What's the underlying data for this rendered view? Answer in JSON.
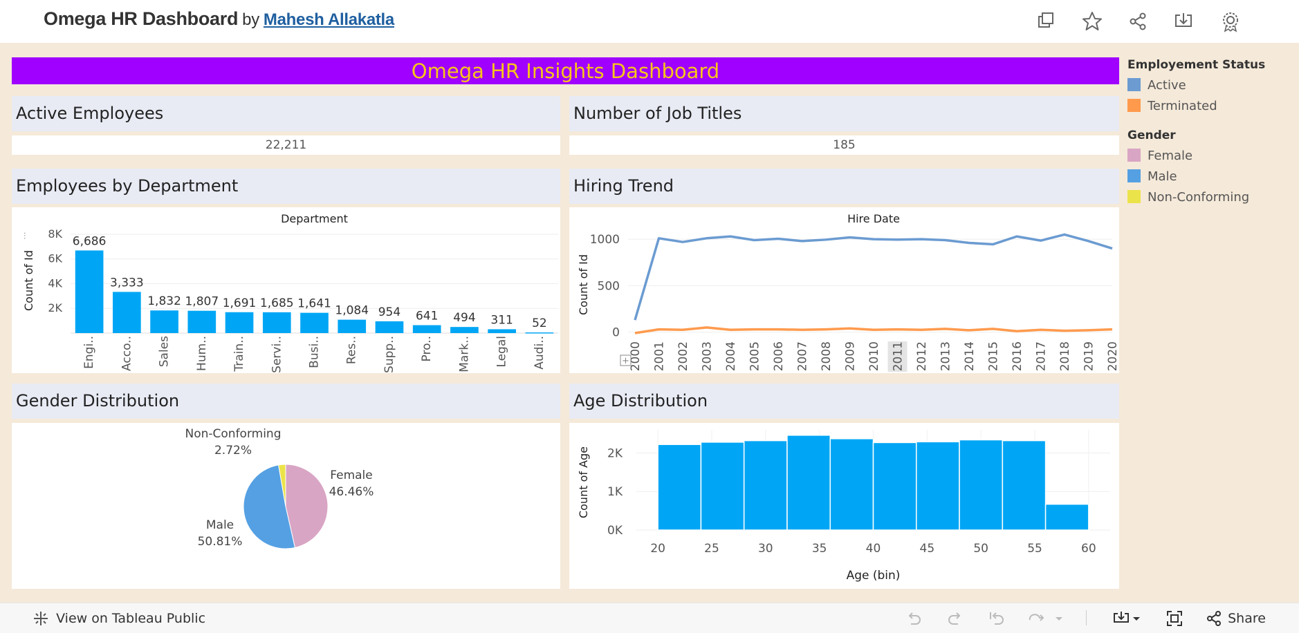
{
  "header": {
    "title": "Omega HR Dashboard",
    "by": "by",
    "author": "Mahesh Allakatla",
    "icons": [
      "duplicate-icon",
      "star-icon",
      "share-icon",
      "download-icon",
      "badge-icon"
    ]
  },
  "banner": "Omega HR Insights Dashboard",
  "kpis": {
    "active_label": "Active Employees",
    "active_value": "22,211",
    "jobs_label": "Number of Job Titles",
    "jobs_value": "185"
  },
  "panels": {
    "dept": "Employees by Department",
    "hiring": "Hiring Trend",
    "gender": "Gender Distribution",
    "age": "Age Distribution"
  },
  "legend": {
    "status_title": "Employement Status",
    "status_items": [
      {
        "label": "Active",
        "color": "#6b9bd1"
      },
      {
        "label": "Terminated",
        "color": "#ff9a4d"
      }
    ],
    "gender_title": "Gender",
    "gender_items": [
      {
        "label": "Female",
        "color": "#d9a5c4"
      },
      {
        "label": "Male",
        "color": "#55a0e3"
      },
      {
        "label": "Non-Conforming",
        "color": "#ebe34a"
      }
    ]
  },
  "chart_data": [
    {
      "type": "bar",
      "title": "Department",
      "ylabel": "Count of Id",
      "ylim": [
        0,
        8500
      ],
      "yticks": [
        2000,
        4000,
        6000,
        8000
      ],
      "ytick_labels": [
        "2K",
        "4K",
        "6K",
        "8K"
      ],
      "categories": [
        "Engi..",
        "Acco..",
        "Sales",
        "Hum..",
        "Train..",
        "Servi..",
        "Busi..",
        "Res..",
        "Supp..",
        "Pro..",
        "Mark..",
        "Legal",
        "Audi.."
      ],
      "values": [
        6686,
        3333,
        1832,
        1807,
        1691,
        1685,
        1641,
        1084,
        954,
        641,
        494,
        311,
        52
      ],
      "labels": [
        "6,686",
        "3,333",
        "1,832",
        "1,807",
        "1,691",
        "1,685",
        "1,641",
        "1,084",
        "954",
        "641",
        "494",
        "311",
        "52"
      ],
      "color": "#00a6f5"
    },
    {
      "type": "line",
      "title": "Hire Date",
      "ylabel": "Count of Id",
      "ylim": [
        -40,
        1120
      ],
      "yticks": [
        0,
        500,
        1000
      ],
      "x": [
        "2000",
        "2001",
        "2002",
        "2003",
        "2004",
        "2005",
        "2006",
        "2007",
        "2008",
        "2009",
        "2010",
        "2011",
        "2012",
        "2013",
        "2014",
        "2015",
        "2016",
        "2017",
        "2018",
        "2019",
        "2020"
      ],
      "highlight_x": "2011",
      "series": [
        {
          "name": "Active",
          "color": "#6b9bd1",
          "values": [
            130,
            1010,
            970,
            1010,
            1030,
            990,
            1005,
            980,
            995,
            1020,
            1000,
            995,
            1000,
            990,
            960,
            945,
            1030,
            985,
            1050,
            980,
            900
          ]
        },
        {
          "name": "Terminated",
          "color": "#ff9a4d",
          "values": [
            -10,
            30,
            25,
            50,
            25,
            30,
            30,
            25,
            30,
            40,
            25,
            30,
            25,
            35,
            20,
            35,
            10,
            25,
            15,
            20,
            30
          ]
        }
      ]
    },
    {
      "type": "pie",
      "slices": [
        {
          "name": "Female",
          "value": 46.46,
          "label": "46.46%",
          "color": "#d9a5c4"
        },
        {
          "name": "Male",
          "value": 50.81,
          "label": "50.81%",
          "color": "#55a0e3"
        },
        {
          "name": "Non-Conforming",
          "value": 2.72,
          "label": "2.72%",
          "color": "#ebe34a"
        }
      ]
    },
    {
      "type": "bar",
      "xlabel": "Age (bin)",
      "ylabel": "Count of Age",
      "xlim": [
        18,
        62
      ],
      "ylim": [
        0,
        2600
      ],
      "yticks": [
        0,
        1000,
        2000
      ],
      "ytick_labels": [
        "0K",
        "1K",
        "2K"
      ],
      "xticks": [
        20,
        25,
        30,
        35,
        40,
        45,
        50,
        55,
        60
      ],
      "bin_starts": [
        20,
        24,
        28,
        32,
        36,
        40,
        44,
        48,
        52,
        56
      ],
      "bin_width": 4,
      "values": [
        2220,
        2280,
        2320,
        2460,
        2370,
        2270,
        2290,
        2340,
        2320,
        670
      ],
      "color": "#00a6f5"
    }
  ],
  "footer": {
    "view_label": "View on Tableau Public",
    "share_label": "Share"
  }
}
